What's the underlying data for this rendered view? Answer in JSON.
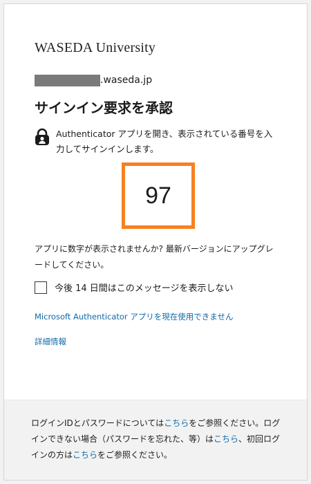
{
  "brand": {
    "logo_text": "WASEDA University"
  },
  "account": {
    "domain_suffix": "waseda.jp"
  },
  "title": "サインイン要求を承認",
  "instruction": {
    "text": "Authenticator アプリを開き、表示されている番号を入力してサインインします。",
    "icon": "lock-person-icon"
  },
  "sign_in_number": "97",
  "help_text": "アプリに数字が表示されませんか? 最新バージョンにアップグレードしてください。",
  "remember": {
    "label": "今後 14 日間はこのメッセージを表示しない",
    "checked": false
  },
  "links": {
    "cant_use_app": "Microsoft Authenticator アプリを現在使用できません",
    "more_info": "詳細情報"
  },
  "footer": {
    "part1": "ログインIDとパスワードについては",
    "link1": "こちら",
    "part2": "をご参照ください。ログインできない場合（パスワードを忘れた、等）は",
    "link2": "こちら",
    "part3": "、初回ログインの方は",
    "link3": "こちら",
    "part4": "をご参照ください。"
  },
  "colors": {
    "accent_box": "#f58220",
    "link": "#0f6aa8",
    "footer_bg": "#f2f2f2"
  }
}
